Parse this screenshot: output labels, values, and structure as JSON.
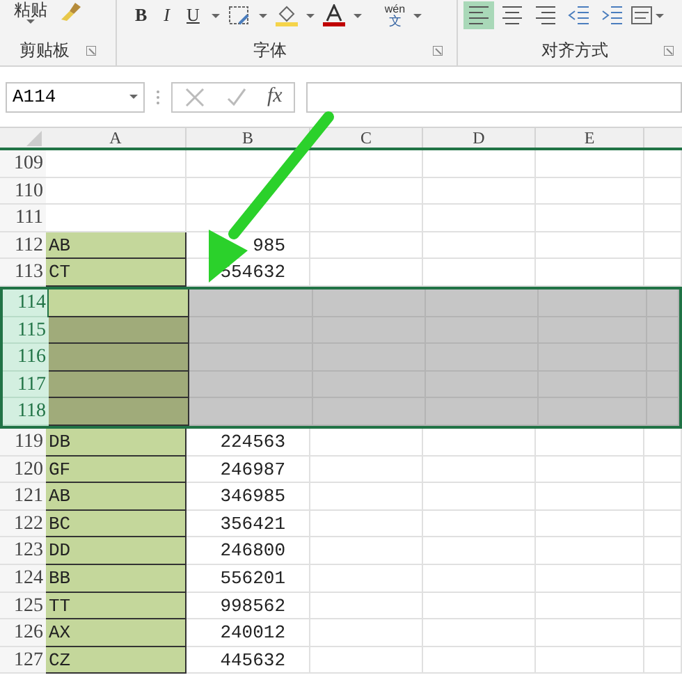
{
  "ribbon": {
    "paste_label": "粘贴",
    "font_buttons": [
      "B",
      "I",
      "U"
    ],
    "phonetic": {
      "top": "wén",
      "bottom": "文"
    },
    "align_buttons": [
      {
        "kind": "left",
        "selected": true
      },
      {
        "kind": "center",
        "selected": false
      },
      {
        "kind": "right",
        "selected": false
      },
      {
        "kind": "outdent",
        "selected": false
      },
      {
        "kind": "indent",
        "selected": false
      }
    ],
    "groups": [
      "剪贴板",
      "字体",
      "对齐方式"
    ]
  },
  "formula_bar": {
    "name_box": "A114",
    "fx": "fx"
  },
  "sheet": {
    "columns": [
      "A",
      "B",
      "C",
      "D",
      "E"
    ],
    "rows": [
      {
        "number": "109",
        "selected": false,
        "active": false
      },
      {
        "number": "110",
        "selected": false,
        "active": false
      },
      {
        "number": "111",
        "selected": false,
        "active": false
      },
      {
        "number": "112",
        "selected": false,
        "active": false,
        "a": "AB",
        "b": "985",
        "color": "#c4d79b"
      },
      {
        "number": "113",
        "selected": false,
        "active": false,
        "a": "CT",
        "b": "554632",
        "color": "#c4d79b"
      },
      {
        "number": "114",
        "selected": true,
        "active": true,
        "color": "#c4d79b"
      },
      {
        "number": "115",
        "selected": true,
        "active": false,
        "color": "#a0ab7a"
      },
      {
        "number": "116",
        "selected": true,
        "active": false,
        "color": "#a0ab7a"
      },
      {
        "number": "117",
        "selected": true,
        "active": false,
        "color": "#a0ab7a"
      },
      {
        "number": "118",
        "selected": true,
        "active": false,
        "color": "#a0ab7a"
      },
      {
        "number": "119",
        "selected": false,
        "active": false,
        "a": "DB",
        "b": "224563",
        "color": "#c4d79b"
      },
      {
        "number": "120",
        "selected": false,
        "active": false,
        "a": "GF",
        "b": "246987",
        "color": "#c4d79b"
      },
      {
        "number": "121",
        "selected": false,
        "active": false,
        "a": "AB",
        "b": "346985",
        "color": "#c4d79b"
      },
      {
        "number": "122",
        "selected": false,
        "active": false,
        "a": "BC",
        "b": "356421",
        "color": "#c4d79b"
      },
      {
        "number": "123",
        "selected": false,
        "active": false,
        "a": "DD",
        "b": "246800",
        "color": "#c4d79b"
      },
      {
        "number": "124",
        "selected": false,
        "active": false,
        "a": "BB",
        "b": "556201",
        "color": "#c4d79b"
      },
      {
        "number": "125",
        "selected": false,
        "active": false,
        "a": "TT",
        "b": "998562",
        "color": "#c4d79b"
      },
      {
        "number": "126",
        "selected": false,
        "active": false,
        "a": "AX",
        "b": "240012",
        "color": "#c4d79b"
      },
      {
        "number": "127",
        "selected": false,
        "active": false,
        "a": "CZ",
        "b": "445632",
        "color": "#c4d79b"
      }
    ]
  }
}
